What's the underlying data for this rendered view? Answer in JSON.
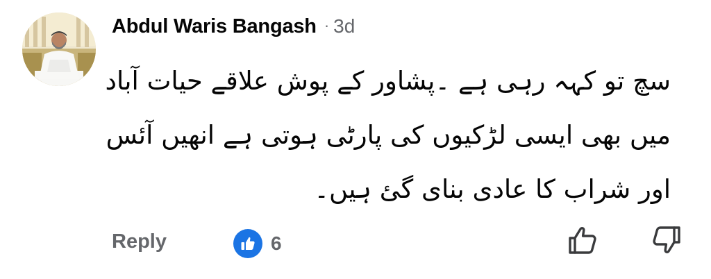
{
  "comment": {
    "author": "Abdul Waris Bangash",
    "separator": "·",
    "timestamp": "3d",
    "text_lines": [
      "سچ تو کہہ رہی ہے ۔پشاور کے پوش علاقے حیات آباد",
      "میں بھی ایسی لڑکیوں کی پارٹی ہوتی ہے انھیں آئس",
      "اور شراب کا عادی بنای گئ ہیں۔"
    ]
  },
  "actions": {
    "reply_label": "Reply",
    "reaction_count": "6",
    "reaction_icon": "like-icon",
    "upvote_icon": "thumbs-up-icon",
    "downvote_icon": "thumbs-down-icon"
  },
  "colors": {
    "text_primary": "#050505",
    "text_secondary": "#65676b",
    "like_blue": "#1b74e4",
    "background": "#ffffff"
  }
}
